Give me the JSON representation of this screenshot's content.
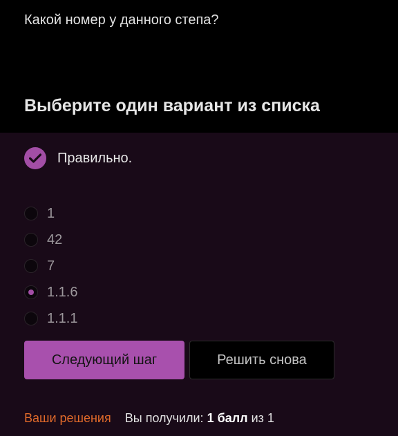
{
  "question": {
    "text": "Какой номер у данного степа?"
  },
  "instruction": {
    "heading": "Выберите один вариант из списка"
  },
  "result": {
    "status_icon": "check-icon",
    "label": "Правильно."
  },
  "options": [
    {
      "label": "1",
      "selected": false
    },
    {
      "label": "42",
      "selected": false
    },
    {
      "label": "7",
      "selected": false
    },
    {
      "label": "1.1.6",
      "selected": true
    },
    {
      "label": "1.1.1",
      "selected": false
    }
  ],
  "actions": {
    "next_label": "Следующий шаг",
    "retry_label": "Решить снова"
  },
  "footer": {
    "solutions_link": "Ваши решения",
    "score_prefix": "Вы получили:",
    "score_value": "1 балл",
    "score_suffix": "из 1"
  },
  "colors": {
    "accent": "#a850ad",
    "panel_background": "#190a18",
    "link": "#e06a2a"
  }
}
